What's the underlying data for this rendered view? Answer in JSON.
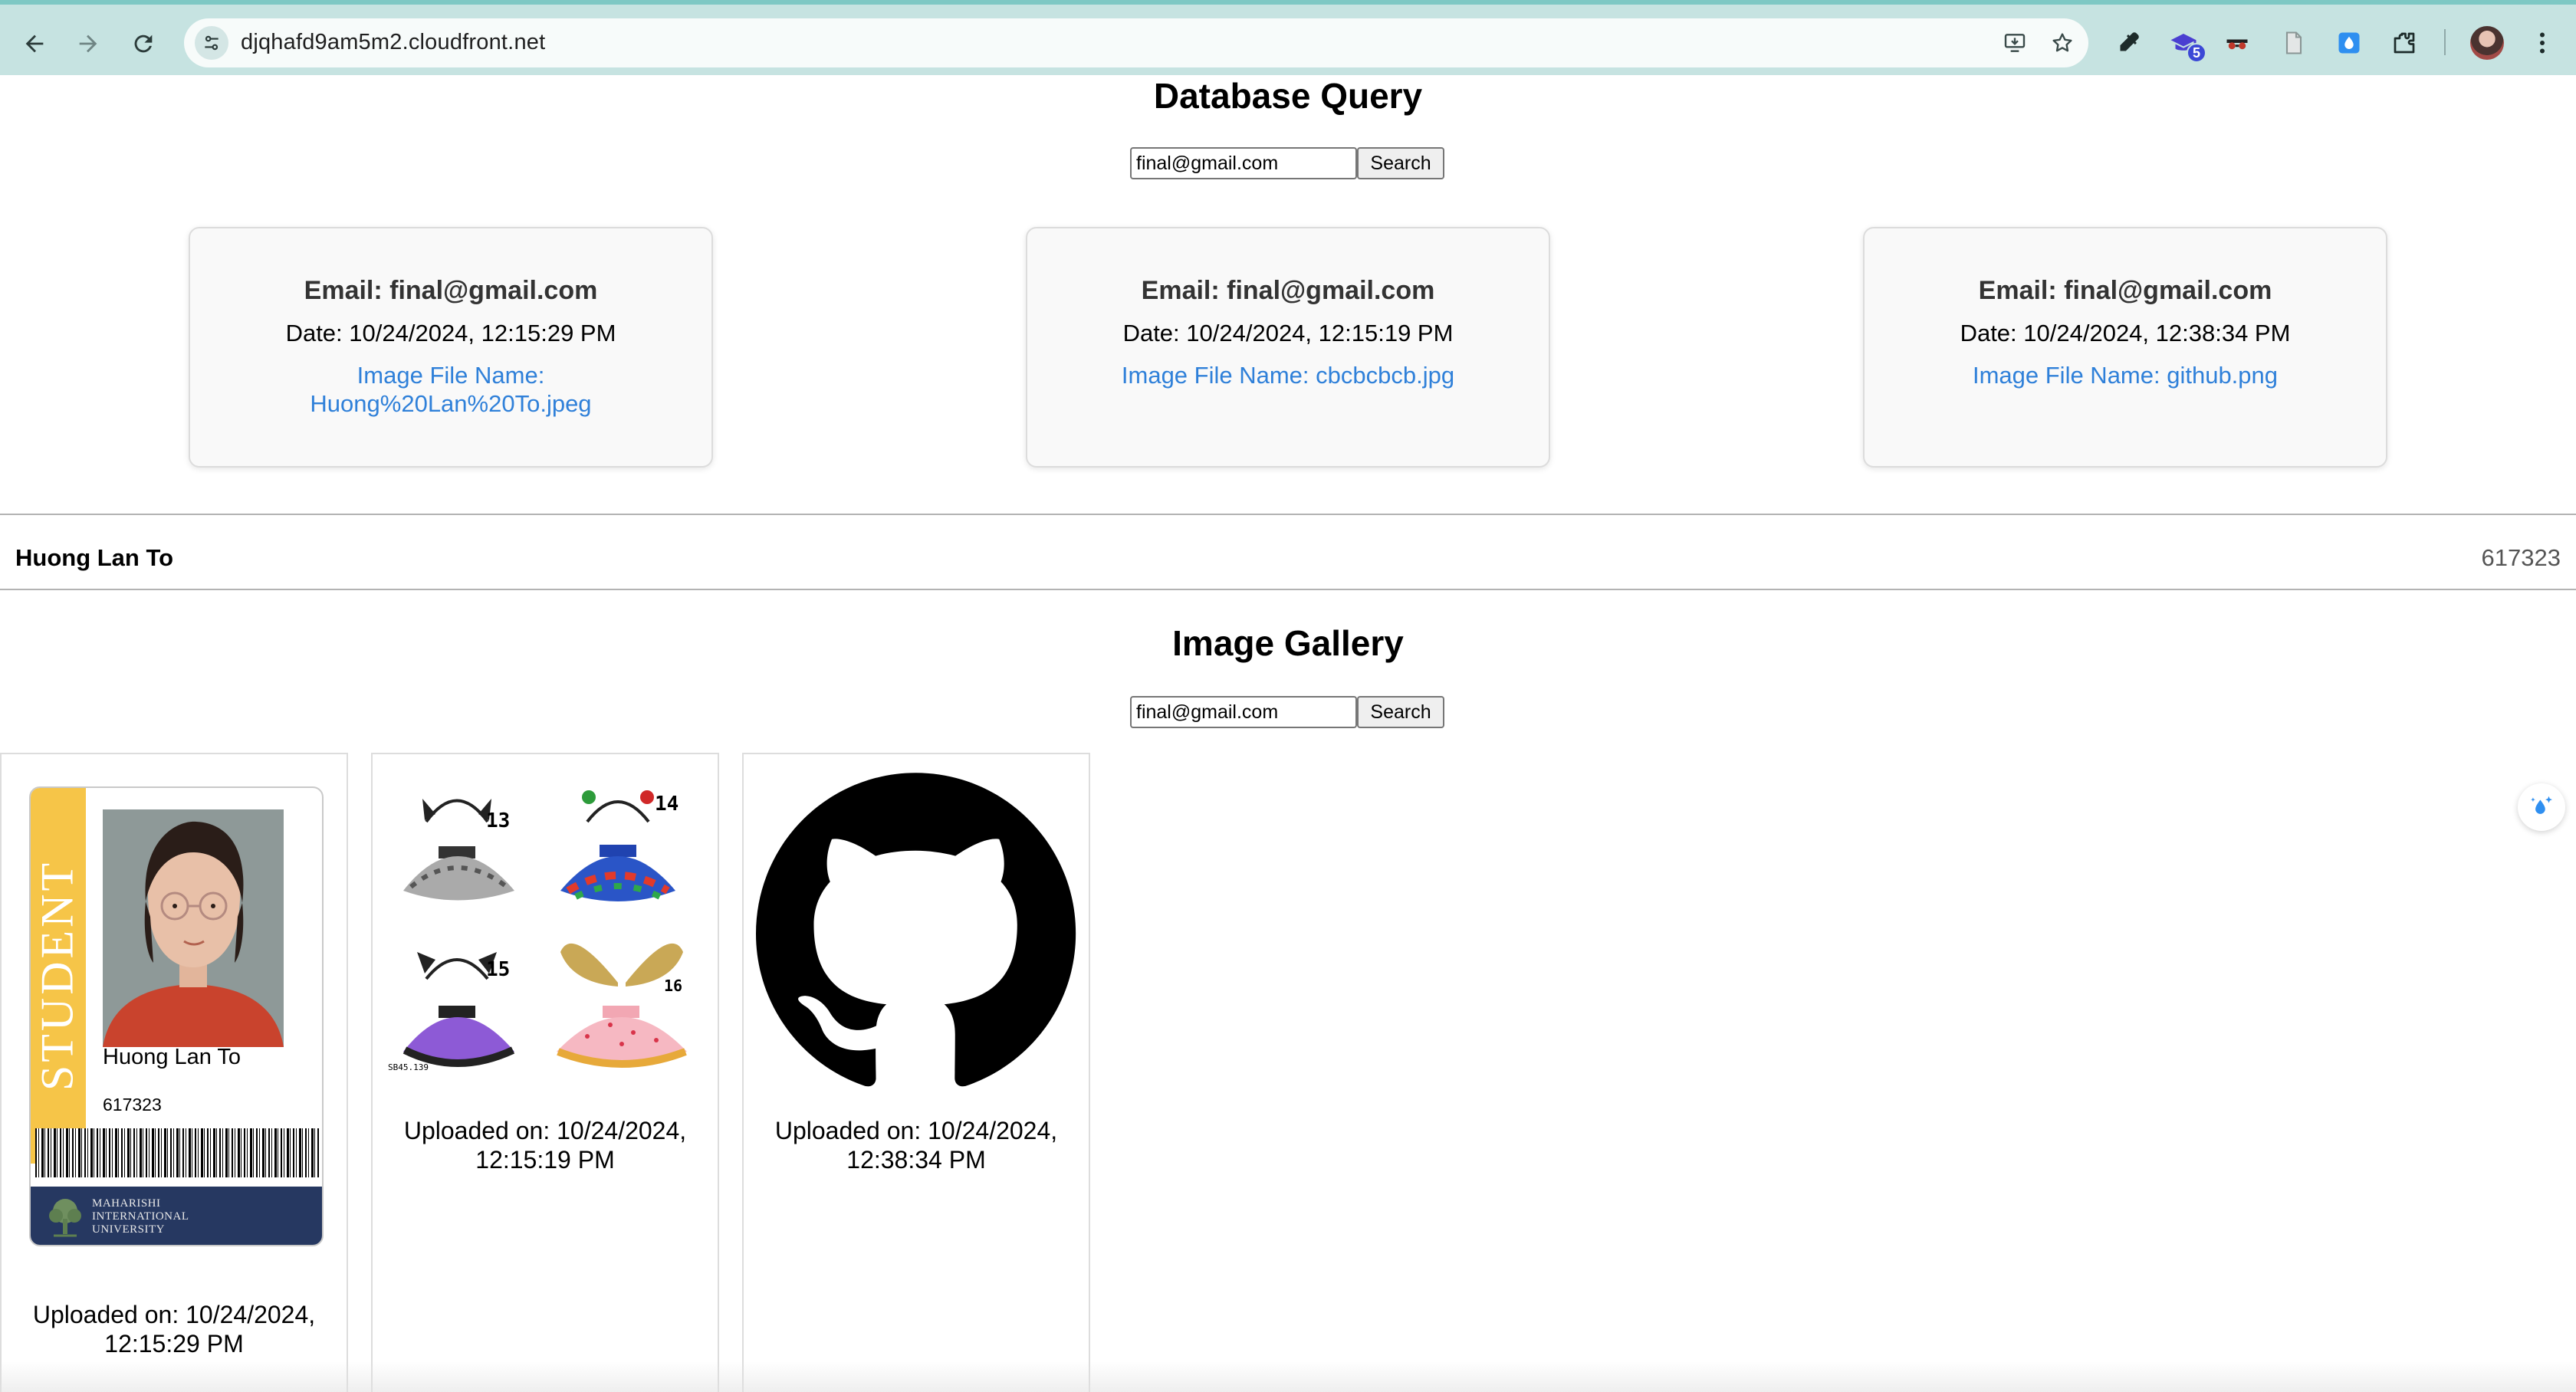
{
  "browser": {
    "url": "djqhafd9am5m2.cloudfront.net",
    "extension_badge": "5"
  },
  "query_section": {
    "title": "Database Query",
    "search_value": "final@gmail.com",
    "search_button": "Search",
    "results": [
      {
        "email": "Email: final@gmail.com",
        "date": "Date: 10/24/2024, 12:15:29 PM",
        "file": "Image File Name: Huong%20Lan%20To.jpeg"
      },
      {
        "email": "Email: final@gmail.com",
        "date": "Date: 10/24/2024, 12:15:19 PM",
        "file": "Image File Name: cbcbcbcb.jpg"
      },
      {
        "email": "Email: final@gmail.com",
        "date": "Date: 10/24/2024, 12:38:34 PM",
        "file": "Image File Name: github.png"
      }
    ]
  },
  "user_bar": {
    "name": "Huong Lan To",
    "id": "617323"
  },
  "gallery": {
    "title": "Image Gallery",
    "search_value": "final@gmail.com",
    "search_button": "Search",
    "items": [
      {
        "caption": "Uploaded on: 10/24/2024, 12:15:29 PM",
        "id_card": {
          "banner": "STUDENT",
          "name": "Huong Lan To",
          "number": "617323",
          "university": [
            "MAHARISHI",
            "INTERNATIONAL",
            "UNIVERSITY"
          ],
          "stripe_color": "#f6c548",
          "footer_color": "#263861"
        }
      },
      {
        "caption": "Uploaded on: 10/24/2024, 12:15:19 PM",
        "tutu_labels": [
          "13",
          "14",
          "15",
          "16",
          "SB45.139"
        ]
      },
      {
        "caption": "Uploaded on: 10/24/2024, 12:38:34 PM",
        "logo": "github-octocat"
      }
    ]
  },
  "colors": {
    "link": "#2f80d9",
    "chrome": "#c6e3e1"
  }
}
